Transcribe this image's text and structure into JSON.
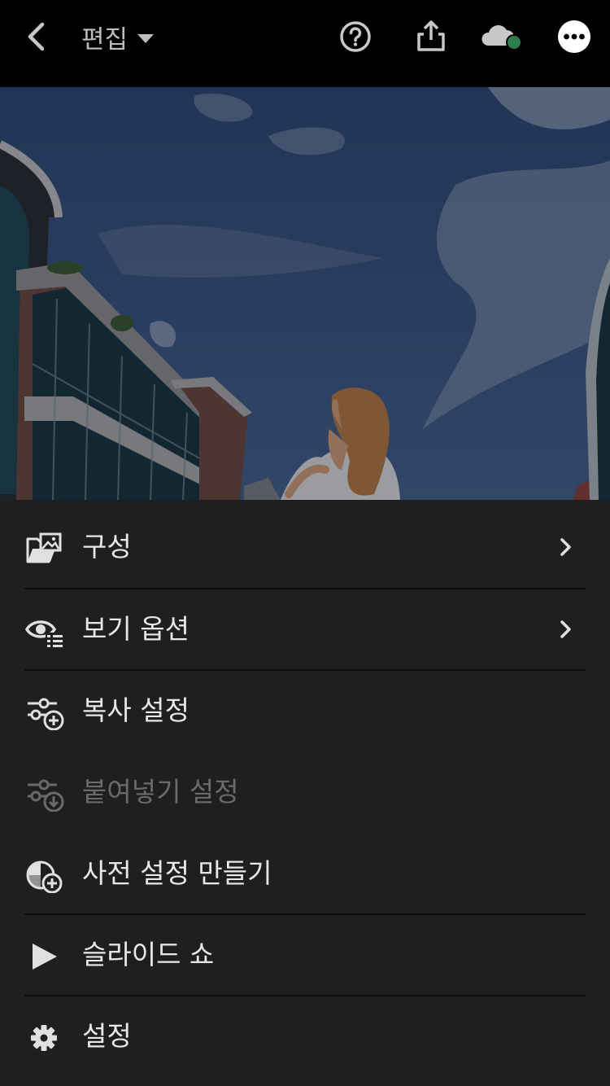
{
  "header": {
    "title": "편집",
    "icons": [
      "back-chevron-icon",
      "dropdown-caret-icon",
      "help-icon",
      "share-icon",
      "cloud-sync-icon",
      "more-icon"
    ],
    "colors": {
      "background": "#000000",
      "icon": "#c8c8c8",
      "sync_dot": "#2e7d4b"
    }
  },
  "photo": {
    "description_alt": "",
    "sky_color": "#3a5a8c"
  },
  "menu": {
    "items": [
      {
        "label": "구성",
        "icon": "folder-images-icon",
        "has_submenu": true,
        "enabled": true
      },
      {
        "label": "보기 옵션",
        "icon": "eye-list-icon",
        "has_submenu": true,
        "enabled": true
      },
      {
        "label": "복사 설정",
        "icon": "sliders-plus-icon",
        "has_submenu": false,
        "enabled": true
      },
      {
        "label": "붙여넣기 설정",
        "icon": "sliders-download-icon",
        "has_submenu": false,
        "enabled": false
      },
      {
        "label": "사전 설정 만들기",
        "icon": "preset-plus-icon",
        "has_submenu": false,
        "enabled": true
      },
      {
        "label": "슬라이드 쇼",
        "icon": "play-icon",
        "has_submenu": false,
        "enabled": true
      },
      {
        "label": "설정",
        "icon": "gear-icon",
        "has_submenu": false,
        "enabled": true
      }
    ],
    "colors": {
      "background": "#1f1f1f",
      "text": "#e8e8e8",
      "disabled_text": "#6a6a6a",
      "divider": "#0e0e0e"
    }
  }
}
